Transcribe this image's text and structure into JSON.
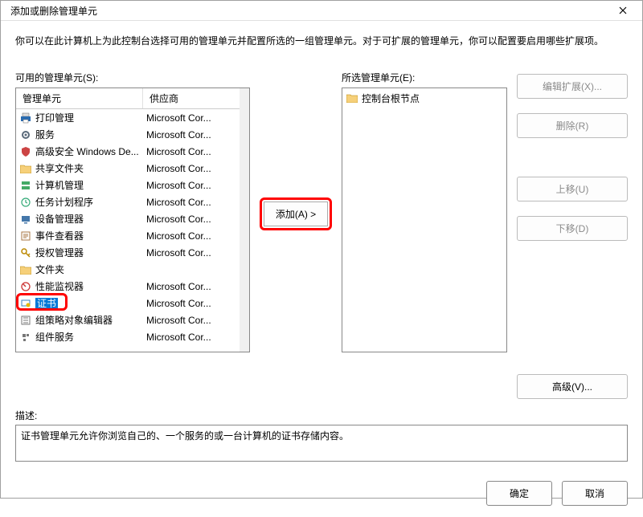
{
  "window": {
    "title": "添加或删除管理单元"
  },
  "instruction": "你可以在此计算机上为此控制台选择可用的管理单元并配置所选的一组管理单元。对于可扩展的管理单元，你可以配置要启用哪些扩展项。",
  "labels": {
    "available": "可用的管理单元(S):",
    "selected": "所选管理单元(E):",
    "columns": {
      "name": "管理单元",
      "vendor": "供应商"
    },
    "add": "添加(A) >",
    "editExt": "编辑扩展(X)...",
    "remove": "删除(R)",
    "moveUp": "上移(U)",
    "moveDown": "下移(D)",
    "advanced": "高级(V)...",
    "desc": "描述:",
    "ok": "确定",
    "cancel": "取消"
  },
  "available": [
    {
      "name": "打印管理",
      "vendor": "Microsoft Cor...",
      "icon": "printer",
      "color": "#2b6cb0"
    },
    {
      "name": "服务",
      "vendor": "Microsoft Cor...",
      "icon": "gear",
      "color": "#5a6a7a"
    },
    {
      "name": "高级安全 Windows De...",
      "vendor": "Microsoft Cor...",
      "icon": "shield",
      "color": "#c44"
    },
    {
      "name": "共享文件夹",
      "vendor": "Microsoft Cor...",
      "icon": "folder-share",
      "color": "#d9a441"
    },
    {
      "name": "计算机管理",
      "vendor": "Microsoft Cor...",
      "icon": "server",
      "color": "#4a6"
    },
    {
      "name": "任务计划程序",
      "vendor": "Microsoft Cor...",
      "icon": "clock",
      "color": "#3a7"
    },
    {
      "name": "设备管理器",
      "vendor": "Microsoft Cor...",
      "icon": "device",
      "color": "#47a"
    },
    {
      "name": "事件查看器",
      "vendor": "Microsoft Cor...",
      "icon": "event",
      "color": "#a74"
    },
    {
      "name": "授权管理器",
      "vendor": "Microsoft Cor...",
      "icon": "key",
      "color": "#b80"
    },
    {
      "name": "文件夹",
      "vendor": "",
      "icon": "folder",
      "color": "#d9a441"
    },
    {
      "name": "性能监视器",
      "vendor": "Microsoft Cor...",
      "icon": "perf",
      "color": "#c33"
    },
    {
      "name": "证书",
      "vendor": "Microsoft Cor...",
      "icon": "cert",
      "color": "#3b82c4",
      "selected": true
    },
    {
      "name": "组策略对象编辑器",
      "vendor": "Microsoft Cor...",
      "icon": "gpo",
      "color": "#777"
    },
    {
      "name": "组件服务",
      "vendor": "Microsoft Cor...",
      "icon": "component",
      "color": "#777"
    }
  ],
  "selected": {
    "root": "控制台根节点"
  },
  "description": "证书管理单元允许你浏览自己的、一个服务的或一台计算机的证书存储内容。"
}
